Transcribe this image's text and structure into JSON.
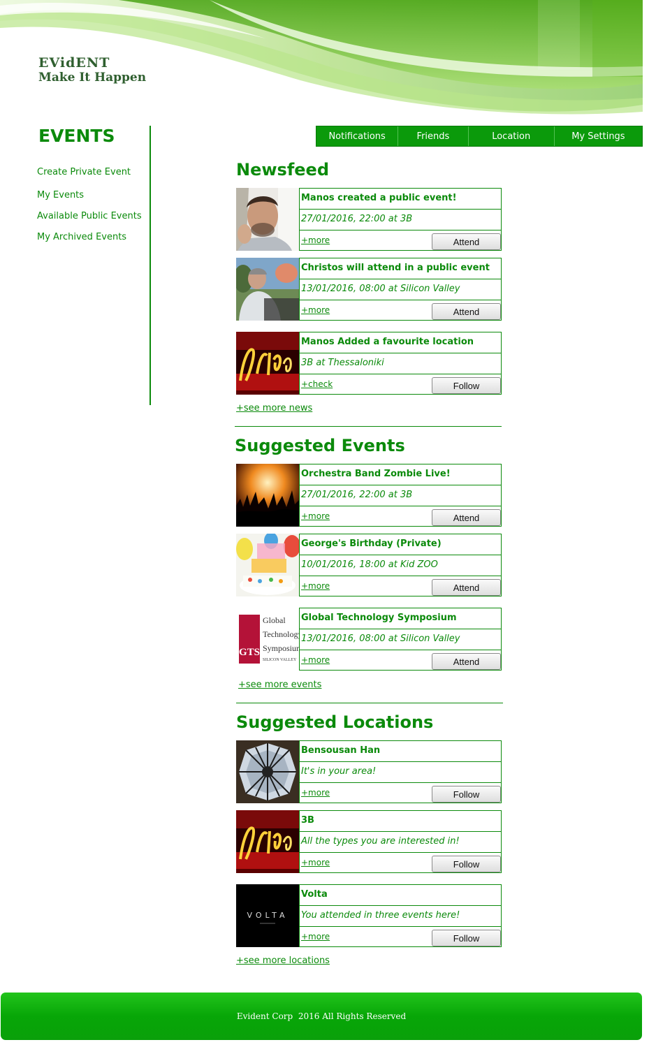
{
  "brand": {
    "name": "EVidENT",
    "tagline": "Make It Happen"
  },
  "sidebar": {
    "title": "EVENTS",
    "links": [
      "Create Private Event",
      "My Events",
      "Available Public Events",
      "My Archived Events"
    ]
  },
  "nav": {
    "items": [
      "Notifications",
      "Friends",
      "Location",
      "My Settings"
    ]
  },
  "newsfeed": {
    "title": "Newsfeed",
    "items": [
      {
        "title": "Manos created a public event!",
        "detail": "27/01/2016, 22:00 at 3B",
        "link": "+more",
        "button": "Attend"
      },
      {
        "title": "Christos will attend in a public event",
        "detail": "13/01/2016, 08:00 at Silicon Valley",
        "link": "+more",
        "button": "Attend"
      },
      {
        "title": "Manos Added a favourite location",
        "detail": "3B at Thessaloniki",
        "link": "+check",
        "button": "Follow"
      }
    ],
    "see_more": "+see more news"
  },
  "suggested_events": {
    "title": "Suggested Events",
    "items": [
      {
        "title": "Orchestra Band Zombie Live!",
        "detail": "27/01/2016, 22:00 at 3B",
        "link": "+more",
        "button": "Attend"
      },
      {
        "title": "George's Birthday (Private)",
        "detail": "10/01/2016, 18:00 at Kid ZOO",
        "link": "+more",
        "button": "Attend"
      },
      {
        "title": "Global Technology Symposium",
        "detail": "13/01/2016, 08:00 at Silicon Valley",
        "link": "+more",
        "button": "Attend",
        "logo": {
          "mark": "GTS",
          "lines": [
            "Global",
            "Technology",
            "Symposium",
            "SILICON VALLEY"
          ]
        }
      }
    ],
    "see_more": "+see more events"
  },
  "suggested_locations": {
    "title": "Suggested Locations",
    "items": [
      {
        "title": "Bensousan Han",
        "detail": "It's in your area!",
        "link": "+more",
        "button": "Follow"
      },
      {
        "title": "3B",
        "detail": "All the types you are interested in!",
        "link": "+more",
        "button": "Follow"
      },
      {
        "title": "Volta",
        "detail": "You attended in three events here!",
        "link": "+more",
        "button": "Follow",
        "logo": {
          "mark": "VOLTA"
        }
      }
    ],
    "see_more": "+see more locations"
  },
  "footer": {
    "text": "Evident Corp  2016 All Rights Reserved"
  },
  "colors": {
    "primary_green": "#0b8a0b",
    "nav_green": "#0b9a0b",
    "footer_green": "#07a607"
  }
}
